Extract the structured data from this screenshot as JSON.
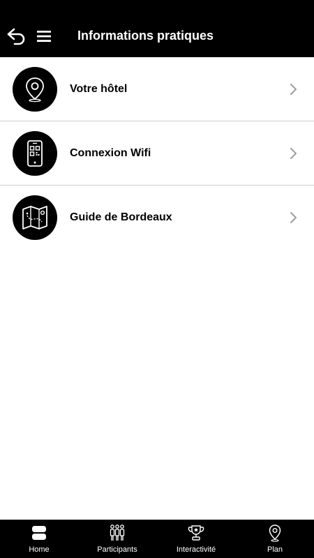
{
  "header": {
    "title": "Informations pratiques"
  },
  "items": [
    {
      "label": "Votre hôtel",
      "icon": "location-pin-icon"
    },
    {
      "label": "Connexion Wifi",
      "icon": "qr-phone-icon"
    },
    {
      "label": "Guide de Bordeaux",
      "icon": "map-icon"
    }
  ],
  "tabs": [
    {
      "label": "Home",
      "icon": "home-icon"
    },
    {
      "label": "Participants",
      "icon": "participants-icon"
    },
    {
      "label": "Interactivité",
      "icon": "trophy-icon"
    },
    {
      "label": "Plan",
      "icon": "location-pin-icon"
    }
  ],
  "colors": {
    "bar": "#000000",
    "background": "#ffffff",
    "divider": "#cfcfcf",
    "chevron": "#9e9e9e"
  }
}
